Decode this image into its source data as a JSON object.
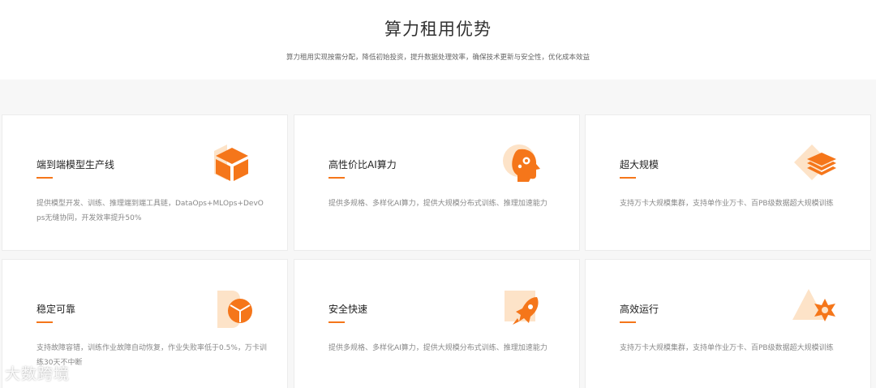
{
  "header": {
    "title": "算力租用优势",
    "subtitle": "算力租用实现按需分配，降低初始投资，提升数据处理效率，确保技术更新与安全性，优化成本效益"
  },
  "cards": [
    {
      "title": "端到端模型生产线",
      "desc": "提供模型开发、训练、推理端到端工具链，DataOps+MLOps+DevOps无缝协同，开发效率提升50%",
      "icon": "cube-icon"
    },
    {
      "title": "高性价比AI算力",
      "desc": "提供多规格、多样化AI算力，提供大规模分布式训练、推理加速能力",
      "icon": "ai-head-icon"
    },
    {
      "title": "超大规模",
      "desc": "支持万卡大规模集群，支持单作业万卡、百PB级数据超大规模训练",
      "icon": "layers-icon"
    },
    {
      "title": "稳定可靠",
      "desc": "支持故障容错，训练作业故障自动恢复，作业失败率低于0.5%，万卡训练30天不中断",
      "icon": "shield-box-icon"
    },
    {
      "title": "安全快速",
      "desc": "提供多规格、多样化AI算力，提供大规模分布式训练、推理加速能力",
      "icon": "rocket-icon"
    },
    {
      "title": "高效运行",
      "desc": "支持万卡大规模集群，支持单作业万卡、百PB级数据超大规模训练",
      "icon": "star-gear-icon"
    }
  ],
  "watermark": "大数跨境",
  "colors": {
    "accent": "#f5761a",
    "accent_light": "#fde3c8",
    "background": "#f7f7f7"
  }
}
